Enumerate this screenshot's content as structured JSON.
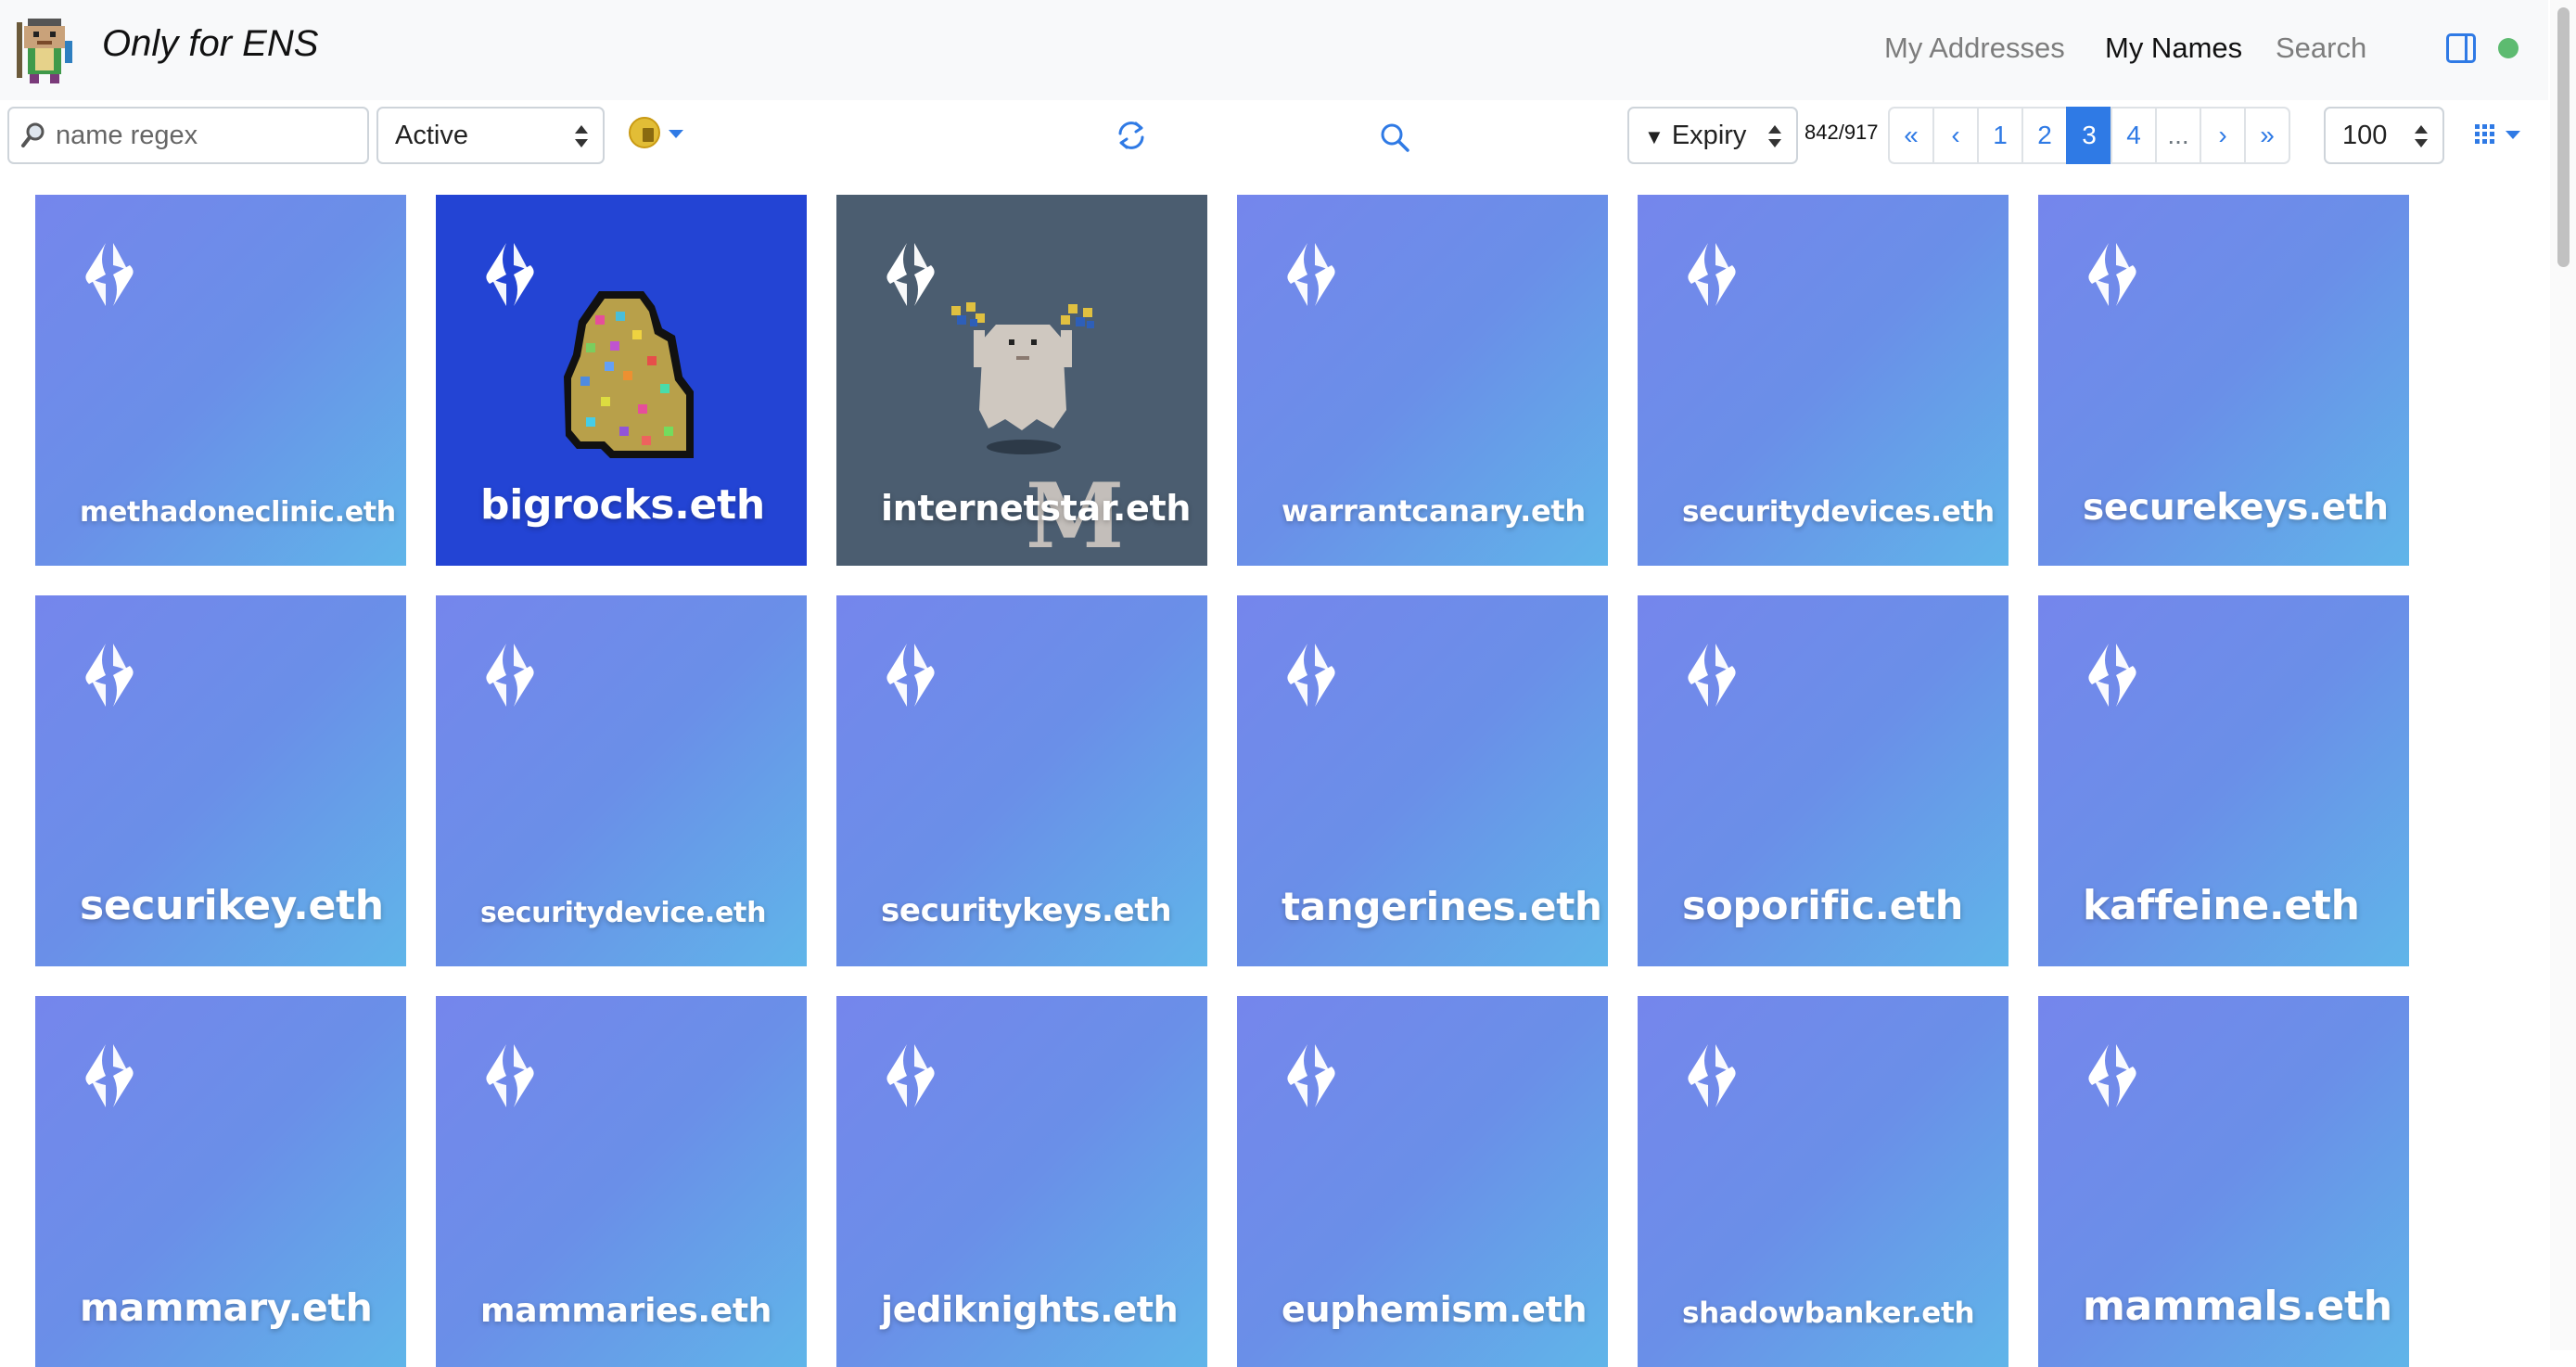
{
  "header": {
    "brand": "Only for ENS",
    "nav": {
      "my_addresses": "My Addresses",
      "my_names": "My Names",
      "search": "Search"
    },
    "status_color": "#5dbb70"
  },
  "toolbar": {
    "search_placeholder": "name regex",
    "status_select": "Active",
    "sort_select": "Expiry",
    "count": "842/917",
    "pagination": [
      "«",
      "‹",
      "1",
      "2",
      "3",
      "4",
      "...",
      "›",
      "»"
    ],
    "current_page": "3",
    "per_page": "100"
  },
  "cards": [
    {
      "name": "methadoneclinic.eth"
    },
    {
      "name": "bigrocks.eth"
    },
    {
      "name": "internetstar.eth"
    },
    {
      "name": "warrantcanary.eth"
    },
    {
      "name": "securitydevices.eth"
    },
    {
      "name": "securekeys.eth"
    },
    {
      "name": "securikey.eth"
    },
    {
      "name": "securitydevice.eth"
    },
    {
      "name": "securitykeys.eth"
    },
    {
      "name": "tangerines.eth"
    },
    {
      "name": "soporific.eth"
    },
    {
      "name": "kaffeine.eth"
    },
    {
      "name": "mammary.eth"
    },
    {
      "name": "mammaries.eth"
    },
    {
      "name": "jediknights.eth"
    },
    {
      "name": "euphemism.eth"
    },
    {
      "name": "shadowbanker.eth"
    },
    {
      "name": "mammals.eth"
    }
  ],
  "card_overlay_letter": "M",
  "colors": {
    "accent": "#2f7ae5",
    "card_gradient_start": "#7586ec",
    "card_gradient_end": "#60b5e9",
    "bigrocks_bg": "#2344d4",
    "internetstar_bg": "#4b5d70"
  }
}
